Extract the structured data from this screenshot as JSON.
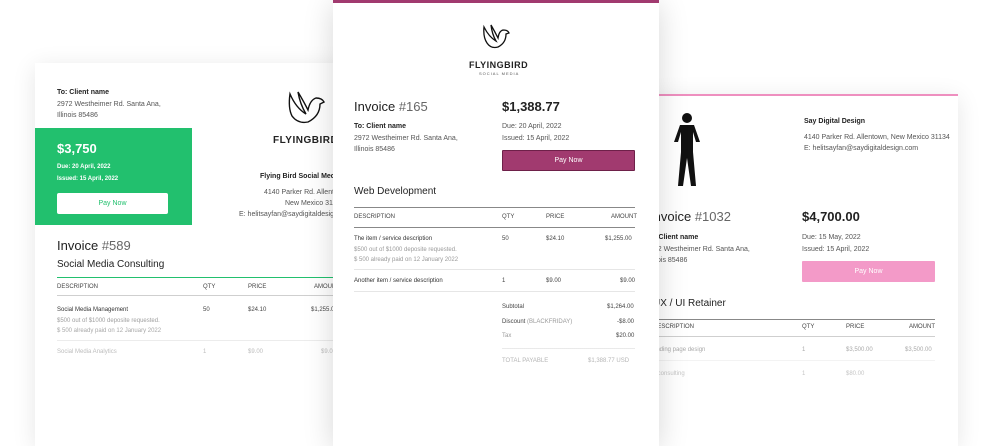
{
  "invoice_a": {
    "to_label": "To: Client name",
    "address_line1": "2972 Westheimer Rd. Santa Ana,",
    "address_line2": "Illinois 85486",
    "amount": "$3,750",
    "due": "Due: 20 April, 2022",
    "issued": "Issued: 15 April, 2022",
    "pay_label": "Pay Now",
    "brand": "FLYINGBIRD",
    "company_name": "Flying Bird Social Med",
    "company_addr1": "4140 Parker Rd. Allentow",
    "company_addr2": "New Mexico 311",
    "company_email": "E: helitsayfan@saydigitaldesign.co",
    "invoice_label": "Invoice",
    "invoice_number": "#589",
    "project": "Social Media Consulting",
    "headers": [
      "DESCRIPTION",
      "QTY",
      "PRICE",
      "AMOUN"
    ],
    "rows": [
      {
        "desc": "Social Media Management",
        "note1": "$500 out of $1000 deposite requested.",
        "note2": "$ 500 already paid on 12 January 2022",
        "qty": "50",
        "price": "$24.10",
        "amount": "$1,255.0"
      },
      {
        "desc": "Social Media Analytics",
        "qty": "1",
        "price": "$9.00",
        "amount": "$9.0"
      }
    ],
    "accent_color": "#22c06e"
  },
  "invoice_b": {
    "brand": "FLYINGBIRD",
    "brand_sub": "SOCIAL MEDIA",
    "invoice_label": "Invoice",
    "invoice_number": "#165",
    "amount": "$1,388.77",
    "to_label": "To: Client name",
    "address_line1": "2972 Westheimer Rd. Santa Ana,",
    "address_line2": "Illinois 85486",
    "due": "Due: 20 April, 2022",
    "issued": "Issued: 15 April, 2022",
    "pay_label": "Pay Now",
    "project": "Web Development",
    "headers": [
      "DESCRIPTION",
      "QTY",
      "PRICE",
      "AMOUNT"
    ],
    "rows": [
      {
        "desc": "The item / service description",
        "note1": "$500 out of $1000 deposite requested.",
        "note2": "$ 500 already paid on 12 January 2022",
        "qty": "50",
        "price": "$24.10",
        "amount": "$1,255.00"
      },
      {
        "desc": "Another item / service description",
        "qty": "1",
        "price": "$9.00",
        "amount": "$9.00"
      }
    ],
    "subtotal_label": "Subtotal",
    "subtotal_value": "$1,264.00",
    "discount_label": "Discount",
    "discount_code": "(BLACKFRIDAY)",
    "discount_value": "-$8.00",
    "tax_label": "Tax",
    "tax_value": "$20.00",
    "total_label": "TOTAL PAYABLE",
    "total_value": "$1,388.77 USD",
    "accent_color": "#a13a6f"
  },
  "invoice_c": {
    "company_name": "Say Digital Design",
    "company_addr": "4140 Parker Rd. Allentown, New Mexico 31134",
    "company_email": "E: helitsayfan@saydigitaldesign.com",
    "invoice_label": "Invoice",
    "invoice_number": "#1032",
    "amount": "$4,700.00",
    "to_label": "o: Client name",
    "address_line1": "972 Westheimer Rd. Santa Ana,",
    "address_line2": "linois 85486",
    "due": "Due: 15 May, 2022",
    "issued": "Issued: 15 April, 2022",
    "pay_label": "Pay Now",
    "project": "UX / UI Retainer",
    "headers": [
      "DESCRIPTION",
      "QTY",
      "PRICE",
      "AMOUNT"
    ],
    "rows": [
      {
        "desc": "anding page design",
        "qty": "1",
        "price": "$3,500.00",
        "amount": "$3,500.00"
      },
      {
        "desc": "Il consulting",
        "qty": "1",
        "price": "$80.00",
        "amount": ""
      }
    ],
    "accent_color": "#ee8fbf"
  }
}
